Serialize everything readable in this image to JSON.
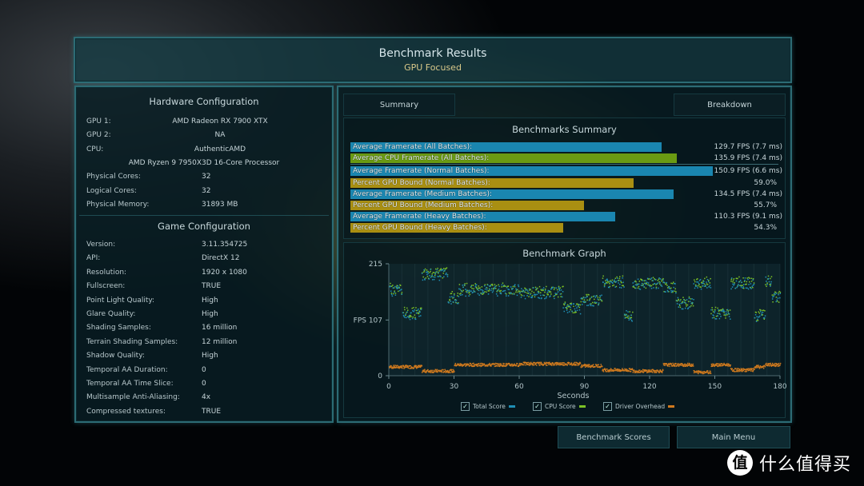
{
  "header": {
    "title": "Benchmark Results",
    "subtitle": "GPU Focused"
  },
  "hardware": {
    "title": "Hardware Configuration",
    "rows": [
      {
        "label": "GPU 1:",
        "value": "AMD Radeon RX 7900 XTX"
      },
      {
        "label": "GPU 2:",
        "value": "NA"
      },
      {
        "label": "CPU:",
        "value": "AuthenticAMD"
      },
      {
        "label": "",
        "value": "AMD Ryzen 9 7950X3D 16-Core Processor"
      },
      {
        "label": "Physical Cores:",
        "value": "32"
      },
      {
        "label": "Logical Cores:",
        "value": "32"
      },
      {
        "label": "Physical Memory:",
        "value": "31893  MB"
      }
    ]
  },
  "game": {
    "title": "Game Configuration",
    "rows": [
      {
        "label": "Version:",
        "value": "3.11.354725"
      },
      {
        "label": "API:",
        "value": "DirectX 12"
      },
      {
        "label": "Resolution:",
        "value": "1920 x 1080"
      },
      {
        "label": "Fullscreen:",
        "value": "TRUE"
      },
      {
        "label": "Point Light Quality:",
        "value": "High"
      },
      {
        "label": "Glare Quality:",
        "value": "High"
      },
      {
        "label": "Shading Samples:",
        "value": "16 million"
      },
      {
        "label": "Terrain Shading Samples:",
        "value": "12 million"
      },
      {
        "label": "Shadow Quality:",
        "value": "High"
      },
      {
        "label": "Temporal AA Duration:",
        "value": "0"
      },
      {
        "label": "Temporal AA Time Slice:",
        "value": "0"
      },
      {
        "label": "Multisample Anti-Aliasing:",
        "value": "4x"
      },
      {
        "label": "Compressed textures:",
        "value": "TRUE"
      }
    ]
  },
  "tabs": {
    "summary": "Summary",
    "breakdown": "Breakdown"
  },
  "summary": {
    "title": "Benchmarks Summary",
    "colors": {
      "framerate": "#1a86b0",
      "cpu": "#6a9a12",
      "gpu_bound": "#a98f12"
    },
    "rows": [
      {
        "label": "Average Framerate (All Batches):",
        "value": "129.7 FPS (7.7 ms)",
        "kind": "framerate",
        "fps": 129.7
      },
      {
        "label": "Average CPU Framerate (All Batches):",
        "value": "135.9 FPS (7.4 ms)",
        "kind": "cpu",
        "fps": 135.9
      },
      {
        "label": "Average Framerate (Normal Batches):",
        "value": "150.9 FPS (6.6 ms)",
        "kind": "framerate",
        "fps": 150.9
      },
      {
        "label": "Percent GPU Bound (Normal Batches):",
        "value": "59.0%",
        "kind": "gpu_bound",
        "percent": 59.0
      },
      {
        "label": "Average Framerate (Medium Batches):",
        "value": "134.5 FPS (7.4 ms)",
        "kind": "framerate",
        "fps": 134.5
      },
      {
        "label": "Percent GPU Bound (Medium Batches):",
        "value": "55.7%",
        "kind": "gpu_bound",
        "percent": 55.7
      },
      {
        "label": "Average Framerate (Heavy Batches):",
        "value": "110.3 FPS (9.1 ms)",
        "kind": "framerate",
        "fps": 110.3
      },
      {
        "label": "Percent GPU Bound (Heavy Batches):",
        "value": "54.3%",
        "kind": "gpu_bound",
        "percent": 54.3
      }
    ]
  },
  "chart_data": {
    "type": "scatter",
    "title": "Benchmark Graph",
    "xlabel": "Seconds",
    "ylabel": "FPS",
    "xlim": [
      0,
      180
    ],
    "ylim": [
      0,
      215
    ],
    "x_ticks": [
      "0",
      "30",
      "60",
      "90",
      "120",
      "150",
      "180"
    ],
    "y_ticks": [
      {
        "value": 215,
        "label": "215"
      },
      {
        "value": 107,
        "label": "FPS 107"
      },
      {
        "value": 0,
        "label": "0"
      }
    ],
    "series": [
      {
        "name": "Total Score",
        "color": "#1f8fb5",
        "segments": [
          [
            0,
            6,
            165
          ],
          [
            6,
            15,
            120
          ],
          [
            15,
            27,
            195
          ],
          [
            27,
            32,
            150
          ],
          [
            32,
            60,
            165
          ],
          [
            60,
            80,
            160
          ],
          [
            80,
            88,
            130
          ],
          [
            88,
            98,
            145
          ],
          [
            98,
            108,
            180
          ],
          [
            108,
            112,
            115
          ],
          [
            112,
            126,
            178
          ],
          [
            126,
            132,
            170
          ],
          [
            132,
            140,
            140
          ],
          [
            140,
            148,
            178
          ],
          [
            148,
            157,
            120
          ],
          [
            157,
            168,
            178
          ],
          [
            168,
            173,
            115
          ],
          [
            173,
            176,
            180
          ],
          [
            176,
            180,
            150
          ]
        ]
      },
      {
        "name": "CPU Score",
        "color": "#7cc226",
        "segments": [
          [
            0,
            6,
            168
          ],
          [
            6,
            15,
            122
          ],
          [
            15,
            27,
            198
          ],
          [
            27,
            32,
            152
          ],
          [
            32,
            60,
            168
          ],
          [
            60,
            80,
            162
          ],
          [
            80,
            88,
            132
          ],
          [
            88,
            98,
            148
          ],
          [
            98,
            108,
            182
          ],
          [
            108,
            112,
            117
          ],
          [
            112,
            126,
            180
          ],
          [
            126,
            132,
            172
          ],
          [
            132,
            140,
            142
          ],
          [
            140,
            148,
            180
          ],
          [
            148,
            157,
            122
          ],
          [
            157,
            168,
            180
          ],
          [
            168,
            173,
            117
          ],
          [
            173,
            176,
            182
          ],
          [
            176,
            180,
            152
          ]
        ]
      },
      {
        "name": "Driver Overhead",
        "color": "#d07a1e",
        "segments": [
          [
            0,
            15,
            18
          ],
          [
            15,
            30,
            10
          ],
          [
            30,
            60,
            22
          ],
          [
            60,
            88,
            24
          ],
          [
            88,
            98,
            20
          ],
          [
            98,
            112,
            12
          ],
          [
            112,
            126,
            10
          ],
          [
            126,
            140,
            22
          ],
          [
            140,
            148,
            8
          ],
          [
            148,
            157,
            22
          ],
          [
            157,
            168,
            12
          ],
          [
            168,
            173,
            18
          ],
          [
            173,
            180,
            22
          ]
        ]
      }
    ],
    "legend": "bottom"
  },
  "legend": [
    {
      "label": "Total Score",
      "color": "#1f8fb5"
    },
    {
      "label": "CPU Score",
      "color": "#7cc226"
    },
    {
      "label": "Driver Overhead",
      "color": "#d07a1e"
    }
  ],
  "buttons": {
    "scores": "Benchmark Scores",
    "menu": "Main Menu"
  },
  "watermark": {
    "logo": "值",
    "text": "什么值得买"
  }
}
